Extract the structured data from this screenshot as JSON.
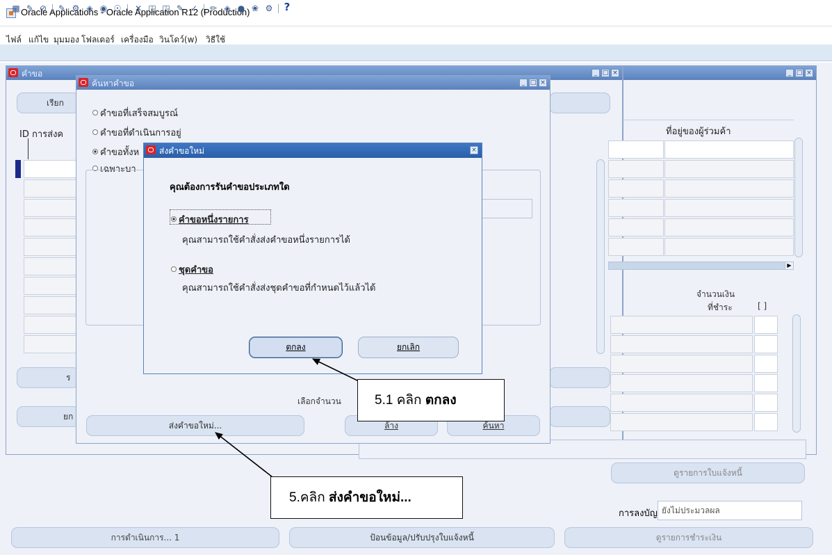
{
  "window": {
    "title": "Oracle Applications - Oracle Application R12 (Production)",
    "menu": [
      "ไฟล์",
      "แก้ไข",
      "มุมมอง",
      "โฟลเดอร์",
      "เครื่องมือ",
      "วินโดว์(w)",
      "วิธีใช้"
    ],
    "help_glyph": "?"
  },
  "bg_window": {
    "title": "คำขอ",
    "button_find": "เรียก",
    "col_id": "ID การส่งค",
    "col_supplier_address": "ที่อยู่ของผู้ร่วมค้า",
    "amount_label_1": "จำนวนเงิน",
    "amount_label_2": "ที่ชำระ",
    "amount_bracket": "[ ]",
    "btn_partial_r": "ร",
    "btn_partial_cancel": "ยก",
    "btn_view_invoice": "ดูรายการใบแจ้งหนี้",
    "posting_label": "การลงบัญชี",
    "posting_value": "ยังไม่ประมวลผล",
    "btn_actions": "การดำเนินการ... 1",
    "btn_enter_invoice": "ป้อนข้อมูล/ปรับปรุงใบแจ้งหนี้",
    "btn_view_payments": "ดูรายการชำระเงิน"
  },
  "find_window": {
    "title": "ค้นหาคำขอ",
    "radio_completed": "คำขอที่เสร็จสมบูรณ์",
    "radio_in_progress": "คำขอที่ดำเนินการอยู่",
    "radio_all": "คำขอทั้งห",
    "radio_specific": "เฉพาะบา",
    "select_count_label": "เลือกจำนวน",
    "btn_submit_new": "ส่งคำขอใหม่...",
    "btn_clear": "ล้าง",
    "btn_find": "ค้นหา"
  },
  "modal": {
    "title": "ส่งคำขอใหม่",
    "question": "คุณต้องการรันคำขอประเภทใด",
    "option1_label": "คำขอหนึ่งรายการ",
    "option1_desc": "คุณสามารถใช้คำสั่งส่งคำขอหนึ่งรายการได้",
    "option2_label": "ชุดคำขอ",
    "option2_desc": "คุณสามารถใช้คำสั่งส่งชุดคำขอที่กำหนดไว้แล้วได้",
    "btn_ok": "ตกลง",
    "btn_cancel": "ยกเลิก"
  },
  "callouts": {
    "c1_prefix": "5.1 คลิก ",
    "c1_bold": "ตกลง",
    "c2_prefix": "5.คลิก ",
    "c2_bold": "ส่งคำขอใหม่..."
  },
  "colors": {
    "mdi_bg": "#eef1f8",
    "titlebar_blue": "#5b82bd",
    "modal_titlebar": "#2a5ea8",
    "oracle_red": "#d8232a"
  }
}
